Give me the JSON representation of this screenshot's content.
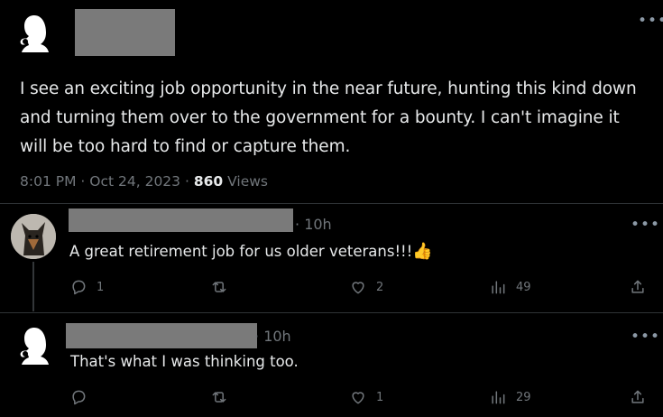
{
  "main_tweet": {
    "text": "I see an exciting job opportunity in the near future,  hunting this kind down and turning them over to the government for a bounty. I can't imagine it will be too hard to find or capture them.",
    "time": "8:01 PM",
    "date": "Oct 24, 2023",
    "views_count": "860",
    "views_label": "Views"
  },
  "replies": [
    {
      "time": "10h",
      "text": "A great retirement job for us older veterans!!!",
      "emoji": "👍",
      "replies": "1",
      "reposts": "",
      "likes": "2",
      "views": "49"
    },
    {
      "time": "10h",
      "text": "That's what I was thinking too.",
      "replies": "",
      "reposts": "",
      "likes": "1",
      "views": "29"
    }
  ],
  "ui": {
    "more_glyph": "•••",
    "separator": "·"
  }
}
